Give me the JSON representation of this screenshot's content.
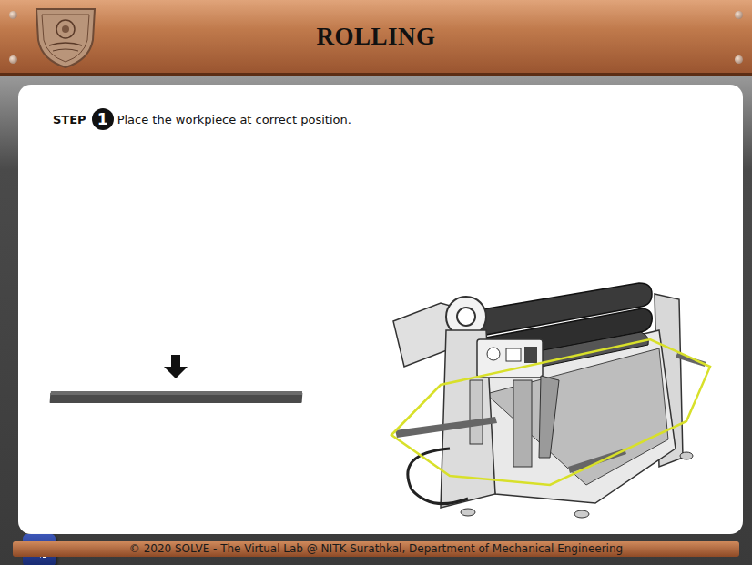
{
  "header": {
    "title": "ROLLING"
  },
  "step": {
    "label": "STEP",
    "number": "1",
    "instruction": "Place the workpiece at correct position."
  },
  "machine": {
    "highlighted": true
  },
  "footer": {
    "text": "© 2020 SOLVE - The Virtual Lab @ NITK Surathkal, Department of Mechanical Engineering"
  }
}
